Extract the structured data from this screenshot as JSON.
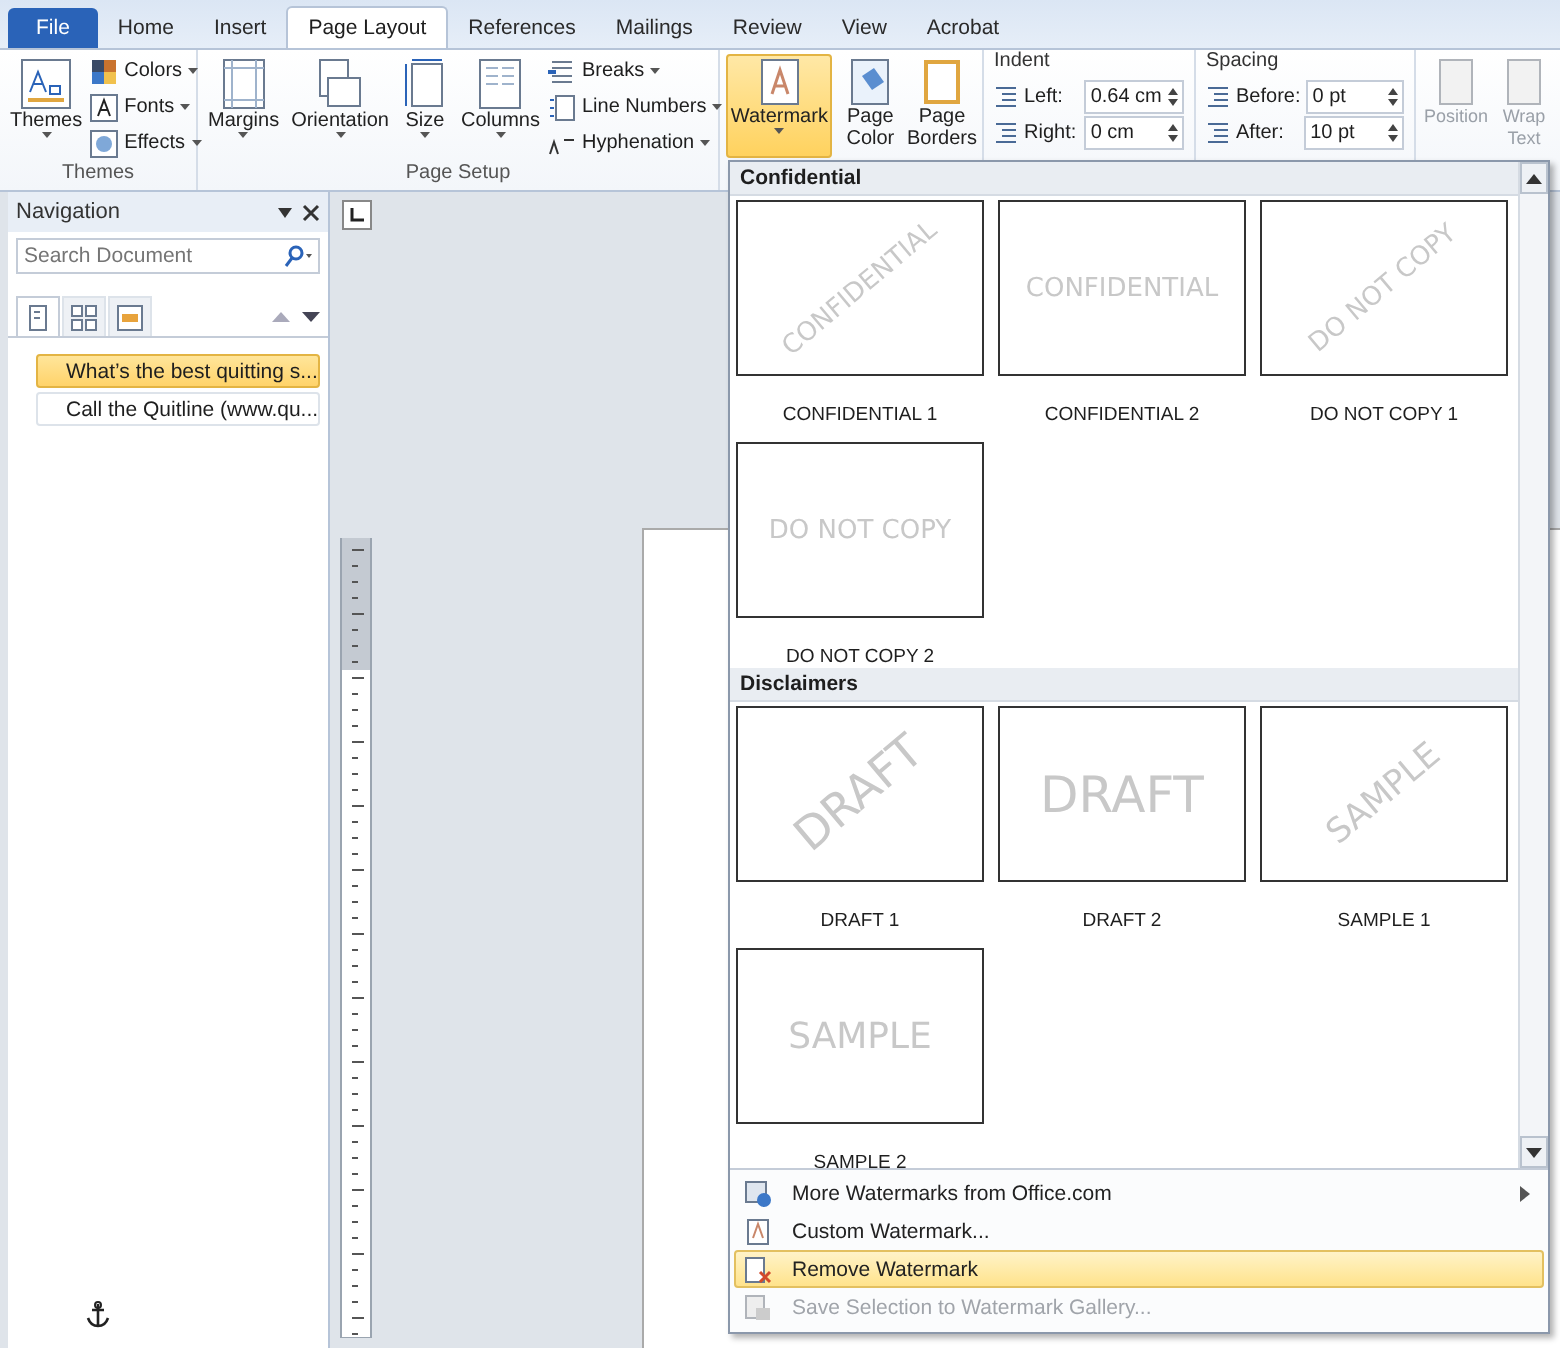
{
  "tabs": [
    {
      "label": "File",
      "kind": "file",
      "selected": false
    },
    {
      "label": "Home",
      "kind": "tab",
      "selected": false
    },
    {
      "label": "Insert",
      "kind": "tab",
      "selected": false
    },
    {
      "label": "Page Layout",
      "kind": "tab",
      "selected": true
    },
    {
      "label": "References",
      "kind": "tab",
      "selected": false
    },
    {
      "label": "Mailings",
      "kind": "tab",
      "selected": false
    },
    {
      "label": "Review",
      "kind": "tab",
      "selected": false
    },
    {
      "label": "View",
      "kind": "tab",
      "selected": false
    },
    {
      "label": "Acrobat",
      "kind": "tab",
      "selected": false
    }
  ],
  "ribbon": {
    "themes_group": {
      "label": "Themes",
      "big": {
        "label": "Themes"
      },
      "small": [
        {
          "label": "Colors"
        },
        {
          "label": "Fonts"
        },
        {
          "label": "Effects"
        }
      ]
    },
    "page_setup_group": {
      "label": "Page Setup",
      "big": [
        {
          "label": "Margins"
        },
        {
          "label": "Orientation"
        },
        {
          "label": "Size"
        },
        {
          "label": "Columns"
        }
      ],
      "small": [
        {
          "label": "Breaks"
        },
        {
          "label": "Line Numbers"
        },
        {
          "label": "Hyphenation"
        }
      ]
    },
    "background_group": [
      {
        "label": "Watermark",
        "active": true
      },
      {
        "label": "Page Color",
        "active": false
      },
      {
        "label": "Page Borders",
        "active": false
      }
    ],
    "indent": {
      "heading": "Indent",
      "fields": [
        {
          "label": "Left:",
          "value": "0.64 cm"
        },
        {
          "label": "Right:",
          "value": "0 cm"
        }
      ]
    },
    "spacing": {
      "heading": "Spacing",
      "fields": [
        {
          "label": "Before:",
          "value": "0 pt"
        },
        {
          "label": "After:",
          "value": "10 pt"
        }
      ]
    },
    "arrange": [
      {
        "label": "Position",
        "disabled": true
      },
      {
        "label": "Wrap Text",
        "disabled": true
      }
    ]
  },
  "navigation": {
    "title": "Navigation",
    "search": {
      "placeholder": "Search Document"
    },
    "views": [
      {
        "selected": true
      },
      {
        "selected": false
      },
      {
        "selected": false
      }
    ],
    "headings": [
      {
        "text": "What’s the best quitting s...",
        "selected": true
      },
      {
        "text": "Call the Quitline (www.qu...",
        "selected": false
      }
    ]
  },
  "watermark_gallery": {
    "sections": [
      {
        "title": "Confidential",
        "items": [
          {
            "mark": "CONFIDENTIAL",
            "label": "CONFIDENTIAL 1",
            "kind": "diagonal"
          },
          {
            "mark": "CONFIDENTIAL",
            "label": "CONFIDENTIAL 2",
            "kind": "horizontal"
          },
          {
            "mark": "DO NOT COPY",
            "label": "DO NOT COPY 1",
            "kind": "diagonal"
          },
          {
            "mark": "DO NOT COPY",
            "label": "DO NOT COPY 2",
            "kind": "horizontal"
          }
        ]
      },
      {
        "title": "Disclaimers",
        "items": [
          {
            "mark": "DRAFT",
            "label": "DRAFT 1",
            "kind": "diagonal"
          },
          {
            "mark": "DRAFT",
            "label": "DRAFT 2",
            "kind": "horizontal"
          },
          {
            "mark": "SAMPLE",
            "label": "SAMPLE 1",
            "kind": "diagonal"
          },
          {
            "mark": "SAMPLE",
            "label": "SAMPLE 2",
            "kind": "horizontal"
          }
        ]
      }
    ],
    "menu": [
      {
        "label": "More Watermarks from Office.com",
        "submenu": true,
        "selected": false,
        "disabled": false
      },
      {
        "label": "Custom Watermark...",
        "submenu": false,
        "selected": false,
        "disabled": false
      },
      {
        "label": "Remove Watermark",
        "submenu": false,
        "selected": true,
        "disabled": false
      },
      {
        "label": "Save Selection to Watermark Gallery...",
        "submenu": false,
        "selected": false,
        "disabled": true
      }
    ]
  }
}
